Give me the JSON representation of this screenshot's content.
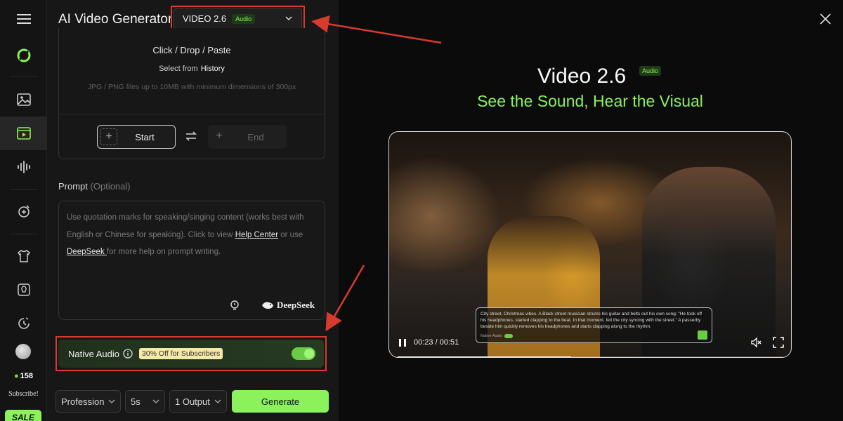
{
  "sidebar": {
    "items": [
      {
        "name": "menu-icon"
      },
      {
        "name": "logo-icon"
      },
      {
        "name": "image-icon"
      },
      {
        "name": "video-icon",
        "active": true
      },
      {
        "name": "audio-wave-icon"
      },
      {
        "name": "effects-icon"
      },
      {
        "name": "shirt-icon"
      },
      {
        "name": "idea-icon"
      },
      {
        "name": "history-icon"
      }
    ],
    "credits": "158",
    "subscribe_label": "Subscribe!",
    "sale_label": "SALE"
  },
  "panel": {
    "title": "AI Video Generator",
    "model_select": {
      "value": "VIDEO 2.6",
      "badge": "Audio"
    },
    "upload": {
      "click_drop": "Click / Drop / Paste",
      "select_from": "Select from",
      "history_link": "History",
      "file_hint": "JPG / PNG files up to 10MB with minimum dimensions of 300px",
      "start_label": "Start",
      "end_label": "End"
    },
    "prompt": {
      "label": "Prompt",
      "optional": "(Optional)",
      "placeholder_part1": "Use quotation marks for speaking/singing content (works best with English or Chinese for speaking). Click to view ",
      "help_link": "Help Center",
      "placeholder_part2": " or use ",
      "deepseek_link": "DeepSeek ",
      "placeholder_part3": "for more help on prompt writing.",
      "deepseek_brand": "DeepSeek"
    },
    "native_audio": {
      "label": "Native Audio",
      "badge": "30% Off for Subscribers",
      "enabled": true
    },
    "footer": {
      "quality": "Profession",
      "duration": "5s",
      "outputs": "1 Output",
      "generate_label": "Generate"
    }
  },
  "preview": {
    "title": "Video 2.6",
    "badge": "Audio",
    "subtitle": "See the Sound, Hear the Visual",
    "video": {
      "caption": "City street, Christmas vibes. A Black street musician strums his guitar and belts out his own song: \"He took off his headphones, started clapping to the beat. In that moment, felt the city syncing with the street.\" A passerby beside him quickly removes his headphones and starts clapping along to the rhythm.",
      "caption_toggle_label": "Native Audio",
      "time": "00:23 / 00:51",
      "progress": 0.45
    }
  },
  "colors": {
    "accent": "#8bf25c",
    "annotation_red": "#d93a2e"
  }
}
